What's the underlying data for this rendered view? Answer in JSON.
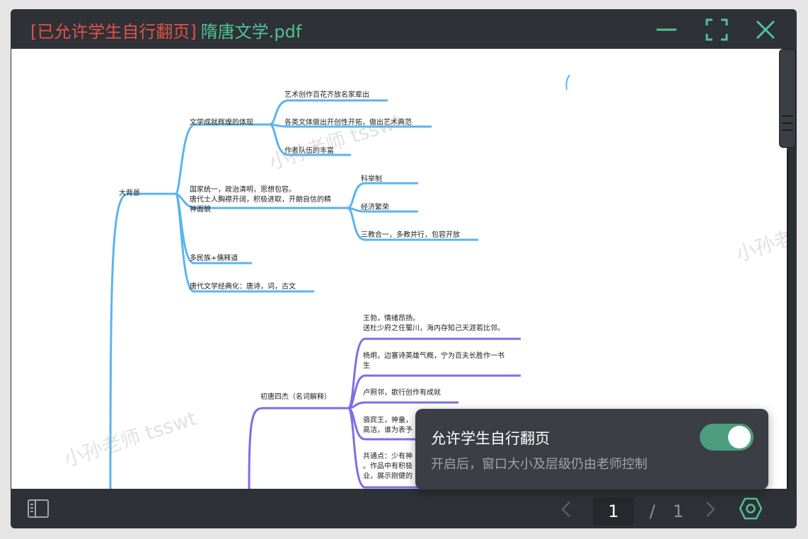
{
  "window": {
    "title_tag": "[已允许学生自行翻页]",
    "title_file": "隋唐文学.pdf"
  },
  "mindmap": {
    "root": "大背景",
    "b1": "文学成就辉煌的体现",
    "b1_1": "艺术创作百花齐放名家辈出",
    "b1_2": "各类文体做出开创性开拓，做出艺术典范",
    "b1_3": "作者队伍的丰富",
    "b2_l1": "国家统一，政治清明，思想包容。",
    "b2_l2": "唐代士人胸襟开阔，积极进取，开朗自信的精",
    "b2_l3": "神面貌",
    "b2_1": "科举制",
    "b2_2": "经济繁荣",
    "b2_3": "三教合一，多教并行，包容开放",
    "b3": "多民族+儒释道",
    "b4": "唐代文学经典化：唐诗，词，古文",
    "p": "初唐四杰（名词解释）",
    "p1_l1": "王勃，情绪昂扬。",
    "p1_l2": "送杜少府之任蜀川，海内存知己天涯若比邻。",
    "p2_l1": "杨炯，边塞诗英雄气概，宁为百夫长胜作一书",
    "p2_l2": "生",
    "p3": "卢照邻，歌行创作有成就",
    "p4_l1": "骆宾王，神童，",
    "p4_l2": "高洁，谁为表予",
    "p5_l1": "共通点：少有神",
    "p5_l2": "。作品中有积极",
    "p5_l3": "业，展示刚健的"
  },
  "watermark": "小孙老师 tsswt",
  "toast": {
    "title": "允许学生自行翻页",
    "subtitle": "开启后，窗口大小及层级仍由老师控制",
    "toggle_on": true
  },
  "pager": {
    "current": "1",
    "separator": "/",
    "total": "1"
  },
  "colors": {
    "accent": "#4fc39a",
    "tag": "#e0524b",
    "branch_blue": "#5ab4f0",
    "branch_purple": "#7b6ee8",
    "toggle": "#4a9e7e"
  },
  "icons": {
    "minimize": "minimize-icon",
    "fullscreen": "fullscreen-icon",
    "close": "close-icon",
    "sidebar": "sidebar-icon",
    "prev": "chevron-left-icon",
    "next": "chevron-right-icon",
    "settings": "settings-icon"
  }
}
